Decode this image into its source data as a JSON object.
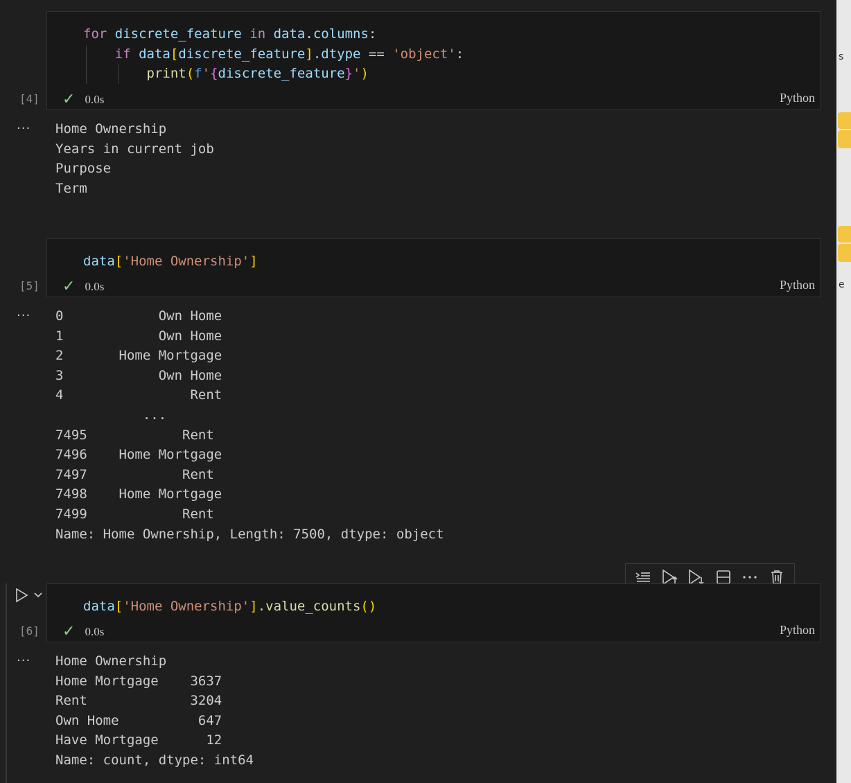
{
  "cells": [
    {
      "exec_count": "[4]",
      "status_time": "0.0s",
      "language": "Python",
      "code": {
        "l1_for": "for",
        "l1_var": "discrete_feature",
        "l1_in": "in",
        "l1_data": "data",
        "l1_dot": ".",
        "l1_cols": "columns",
        "l1_colon": ":",
        "l2_if": "if",
        "l2_data": "data",
        "l2_open": "[",
        "l2_var": "discrete_feature",
        "l2_close": "]",
        "l2_dtype": ".dtype",
        "l2_eq": " == ",
        "l2_str": "'object'",
        "l2_colon": ":",
        "l3_print": "print",
        "l3_open": "(",
        "l3_f": "f",
        "l3_q1": "'",
        "l3_lb": "{",
        "l3_var": "discrete_feature",
        "l3_rb": "}",
        "l3_q2": "'",
        "l3_close": ")"
      },
      "output": [
        "Home Ownership",
        "Years in current job",
        "Purpose",
        "Term"
      ]
    },
    {
      "exec_count": "[5]",
      "status_time": "0.0s",
      "language": "Python",
      "code": {
        "data": "data",
        "open": "[",
        "str": "'Home Ownership'",
        "close": "]"
      },
      "output": [
        "0            Own Home",
        "1            Own Home",
        "2       Home Mortgage",
        "3            Own Home",
        "4                Rent",
        "           ...",
        "7495            Rent",
        "7496    Home Mortgage",
        "7497            Rent",
        "7498    Home Mortgage",
        "7499            Rent",
        "Name: Home Ownership, Length: 7500, dtype: object"
      ]
    },
    {
      "exec_count": "[6]",
      "status_time": "0.0s",
      "language": "Python",
      "code": {
        "data": "data",
        "open": "[",
        "str": "'Home Ownership'",
        "close": "]",
        "method": ".value_counts",
        "parens": "()"
      },
      "output": [
        "Home Ownership",
        "Home Mortgage    3637",
        "Rent             3204",
        "Own Home          647",
        "Have Mortgage      12",
        "Name: count, dtype: int64"
      ]
    }
  ],
  "output_more_label": "···",
  "toolbar": {
    "icons": [
      "run-by-line-icon",
      "execute-above-icon",
      "execute-below-icon",
      "split-cell-icon",
      "more-icon",
      "delete-icon"
    ]
  },
  "right_strip": {
    "text1": "s",
    "text2": "e"
  },
  "colors": {
    "background": "#1f1f1f",
    "cell_bg": "#181818",
    "check": "#89d185",
    "keyword": "#c586c0",
    "variable": "#9cdcfe",
    "string": "#ce9178",
    "function": "#dcdcaa"
  }
}
